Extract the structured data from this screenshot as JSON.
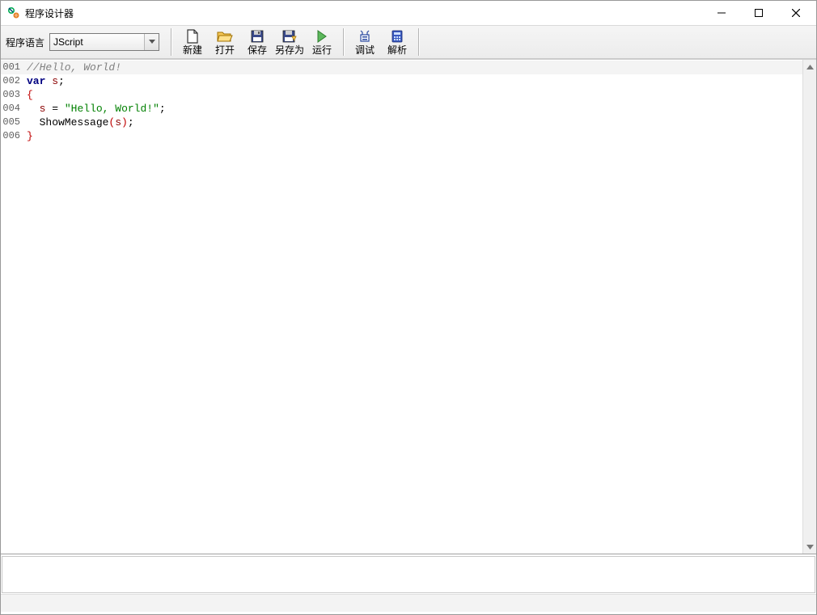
{
  "window": {
    "title": "程序设计器"
  },
  "toolbar": {
    "lang_label": "程序语言",
    "lang_value": "JScript",
    "new": "新建",
    "open": "打开",
    "save": "保存",
    "saveas": "另存为",
    "run": "运行",
    "debug": "调试",
    "parse": "解析"
  },
  "code": {
    "lines": [
      {
        "n": "001",
        "hl": true,
        "tokens": [
          {
            "c": "c-comment",
            "t": "//Hello, World!"
          }
        ]
      },
      {
        "n": "002",
        "hl": false,
        "tokens": [
          {
            "c": "c-keyword",
            "t": "var"
          },
          {
            "c": "",
            "t": " "
          },
          {
            "c": "c-ident",
            "t": "s"
          },
          {
            "c": "c-punct",
            "t": ";"
          }
        ]
      },
      {
        "n": "003",
        "hl": false,
        "tokens": [
          {
            "c": "c-paren",
            "t": "{"
          }
        ]
      },
      {
        "n": "004",
        "hl": false,
        "tokens": [
          {
            "c": "",
            "t": "  "
          },
          {
            "c": "c-ident",
            "t": "s"
          },
          {
            "c": "",
            "t": " "
          },
          {
            "c": "c-punct",
            "t": "="
          },
          {
            "c": "",
            "t": " "
          },
          {
            "c": "c-string",
            "t": "\"Hello, World!\""
          },
          {
            "c": "c-punct",
            "t": ";"
          }
        ]
      },
      {
        "n": "005",
        "hl": false,
        "tokens": [
          {
            "c": "",
            "t": "  ShowMessage"
          },
          {
            "c": "c-paren",
            "t": "("
          },
          {
            "c": "c-ident",
            "t": "s"
          },
          {
            "c": "c-paren",
            "t": ")"
          },
          {
            "c": "c-punct",
            "t": ";"
          }
        ]
      },
      {
        "n": "006",
        "hl": false,
        "tokens": [
          {
            "c": "c-paren",
            "t": "}"
          }
        ]
      }
    ]
  }
}
